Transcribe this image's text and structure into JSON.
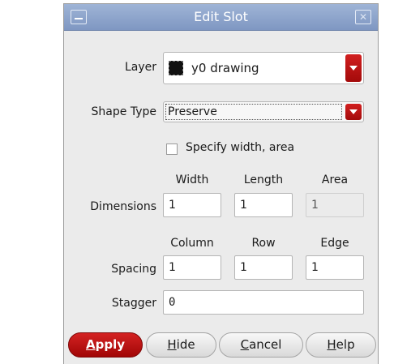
{
  "window": {
    "title": "Edit Slot",
    "min_icon": "minimize-icon",
    "close_icon": "close-icon"
  },
  "layer": {
    "label": "Layer",
    "value": "y0 drawing",
    "swatch_color": "#111111"
  },
  "shape_type": {
    "label": "Shape Type",
    "value": "Preserve"
  },
  "specify": {
    "label": "Specify width, area",
    "checked": false
  },
  "dimensions": {
    "label": "Dimensions",
    "headers": {
      "width": "Width",
      "length": "Length",
      "area": "Area"
    },
    "values": {
      "width": "1",
      "length": "1",
      "area": "1"
    }
  },
  "spacing": {
    "label": "Spacing",
    "headers": {
      "column": "Column",
      "row": "Row",
      "edge": "Edge"
    },
    "values": {
      "column": "1",
      "row": "1",
      "edge": "1"
    }
  },
  "stagger": {
    "label": "Stagger",
    "value": "0"
  },
  "buttons": {
    "apply": {
      "mnemonic": "A",
      "rest": "pply"
    },
    "hide": {
      "mnemonic": "H",
      "rest": "ide"
    },
    "cancel": {
      "mnemonic": "C",
      "rest": "ancel"
    },
    "help": {
      "mnemonic": "H",
      "rest": "elp"
    }
  },
  "colors": {
    "accent": "#b00d0d",
    "titlebar": "#8fa6cc"
  }
}
